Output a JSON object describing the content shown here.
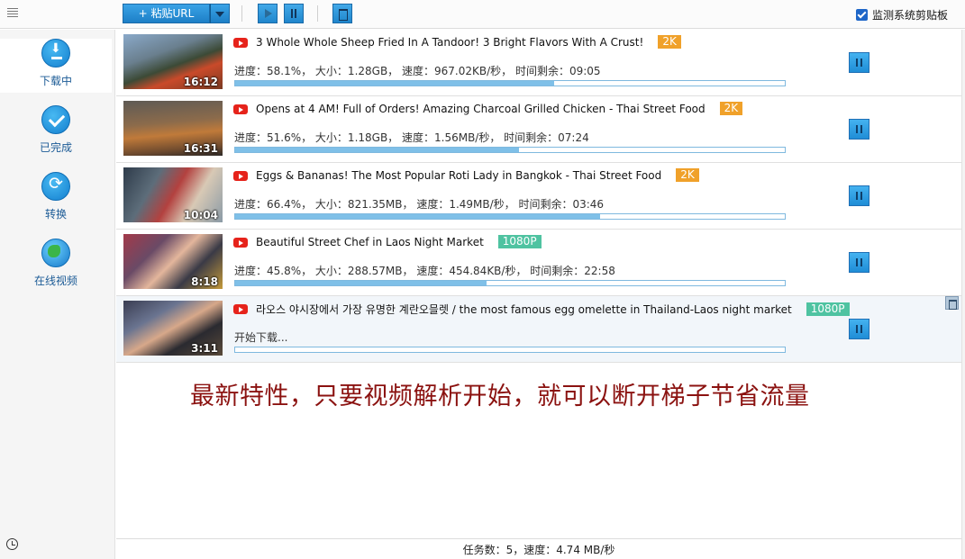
{
  "toolbar": {
    "paste_url_label": "+ 粘贴URL",
    "clipboard_monitor_label": "监测系统剪贴板",
    "clipboard_monitor_checked": true
  },
  "sidebar": {
    "items": [
      {
        "label": "下载中",
        "icon": "download-icon",
        "active": true
      },
      {
        "label": "已完成",
        "icon": "check-circle-icon",
        "active": false
      },
      {
        "label": "转换",
        "icon": "convert-icon",
        "active": false
      },
      {
        "label": "在线视频",
        "icon": "globe-icon",
        "active": false
      }
    ]
  },
  "downloads": [
    {
      "title": "3 Whole Whole Sheep Fried In A Tandoor! 3 Bright Flavors With A Crust!",
      "quality": "2K",
      "duration": "16:12",
      "status": "进度：58.1%， 大小：1.28GB， 速度：967.02KB/秒， 时间剩余：09:05",
      "progress": 0.581
    },
    {
      "title": "Opens at 4 AM! Full of Orders! Amazing Charcoal Grilled Chicken - Thai Street Food",
      "quality": "2K",
      "duration": "16:31",
      "status": "进度：51.6%， 大小：1.18GB， 速度：1.56MB/秒， 时间剩余：07:24",
      "progress": 0.516
    },
    {
      "title": "Eggs & Bananas! The Most Popular Roti Lady in Bangkok - Thai Street Food",
      "quality": "2K",
      "duration": "10:04",
      "status": "进度：66.4%， 大小：821.35MB， 速度：1.49MB/秒， 时间剩余：03:46",
      "progress": 0.664
    },
    {
      "title": "Beautiful Street Chef in Laos Night Market",
      "quality": "1080P",
      "duration": "8:18",
      "status": "进度：45.8%， 大小：288.57MB， 速度：454.84KB/秒， 时间剩余：22:58",
      "progress": 0.458
    },
    {
      "title": "라오스 야시장에서 가장 유명한 계란오믈렛  / the most famous egg omelette in Thailand-Laos night market",
      "quality": "1080P",
      "duration": "3:11",
      "status": "开始下载...",
      "progress": 0
    }
  ],
  "promo_text": "最新特性，只要视频解析开始，就可以断开梯子节省流量",
  "statusbar": "任务数：5，速度：4.74 MB/秒",
  "colors": {
    "accent": "#1f8dd6",
    "badge_2k": "#f0a12a",
    "badge_1080p": "#4fc3a1",
    "promo": "#8b1210",
    "youtube": "#e6231b"
  }
}
